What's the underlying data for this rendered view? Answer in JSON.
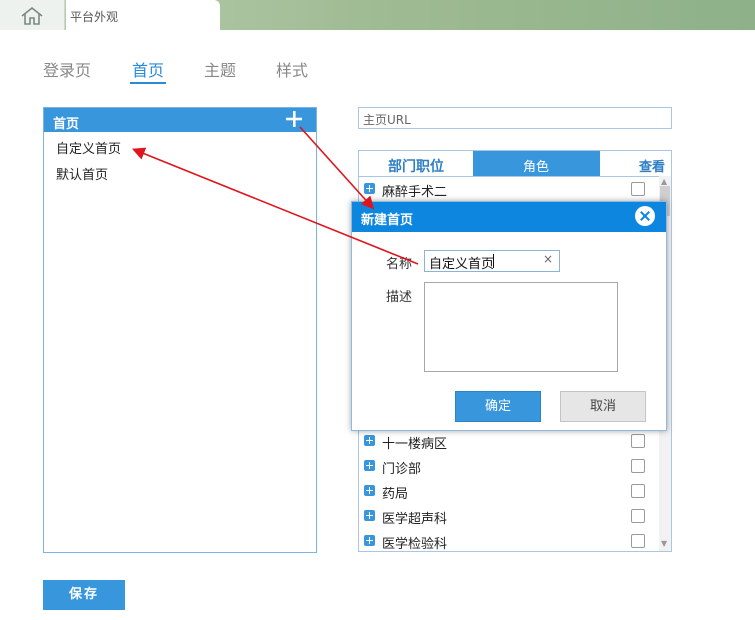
{
  "topbar": {
    "tab_label": "平台外观"
  },
  "nav": {
    "tabs": [
      {
        "label": "登录页"
      },
      {
        "label": "首页"
      },
      {
        "label": "主题"
      },
      {
        "label": "样式"
      }
    ],
    "active": "首页"
  },
  "left_panel": {
    "title": "首页",
    "items": [
      {
        "label": "自定义首页"
      },
      {
        "label": "默认首页"
      }
    ]
  },
  "url_field": {
    "placeholder": "主页URL"
  },
  "right_panel": {
    "tabs": [
      {
        "label": "部门职位"
      },
      {
        "label": "角色"
      },
      {
        "label": "查看"
      }
    ],
    "rows": [
      {
        "label": "麻醉手术二"
      },
      {
        "label": "十一楼病区"
      },
      {
        "label": "门诊部"
      },
      {
        "label": "药局"
      },
      {
        "label": "医学超声科"
      },
      {
        "label": "医学检验科"
      }
    ]
  },
  "modal": {
    "title": "新建首页",
    "name_label": "名称",
    "name_value": "自定义首页",
    "clear_glyph": "×",
    "desc_label": "描述",
    "ok_label": "确定",
    "cancel_label": "取消"
  },
  "save_label": "保存",
  "colors": {
    "accent": "#3796dc",
    "modal_header": "#0d86e0",
    "annotation_arrow": "#e0141c"
  }
}
